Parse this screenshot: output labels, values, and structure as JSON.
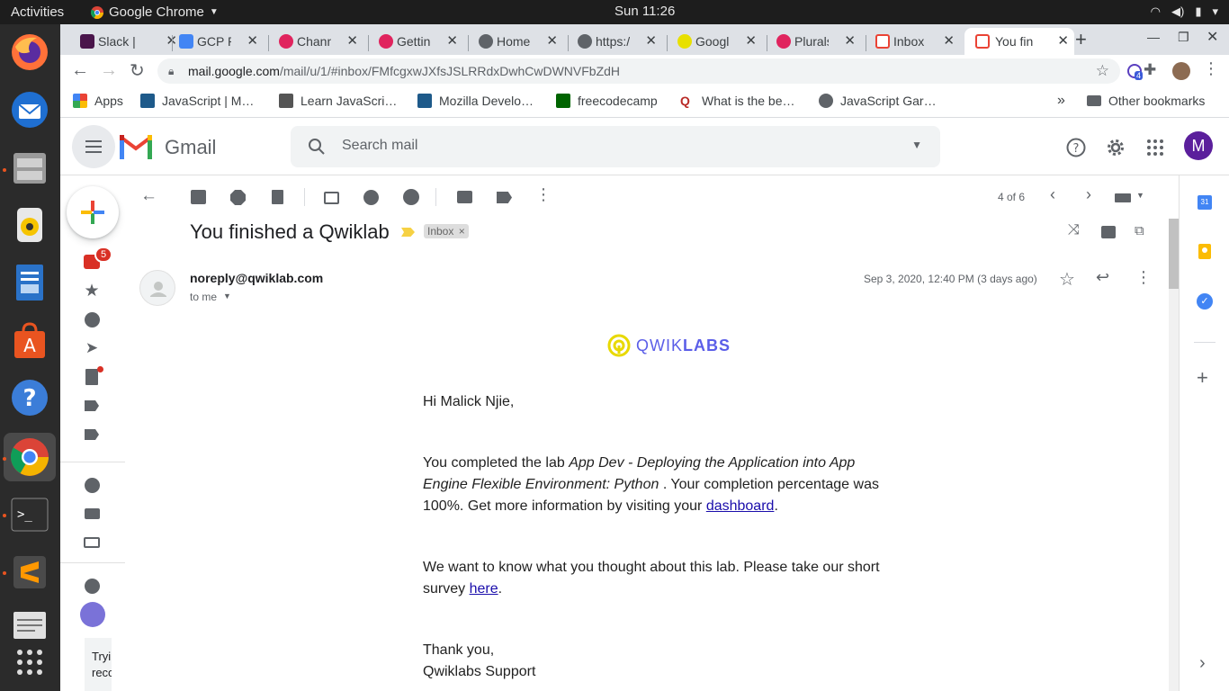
{
  "os": {
    "activities": "Activities",
    "app_name": "Google Chrome",
    "clock": "Sun 11:26"
  },
  "tabs": [
    {
      "label": "Slack | ",
      "color": "#4a154b"
    },
    {
      "label": "GCP Pr",
      "color": "#4285f4"
    },
    {
      "label": "Chann",
      "color": "#e0245e"
    },
    {
      "label": "Getting",
      "color": "#e0245e"
    },
    {
      "label": "Home -",
      "color": "#5f6368"
    },
    {
      "label": "https:/",
      "color": "#5f6368"
    },
    {
      "label": "Google",
      "color": "#e8e000"
    },
    {
      "label": "Plurals",
      "color": "#e0245e"
    },
    {
      "label": "Inbox (",
      "color": "#ea4335"
    },
    {
      "label": "You fin",
      "color": "#ea4335"
    }
  ],
  "url": {
    "host": "mail.google.com",
    "path": "/mail/u/1/#inbox/FMfcgxwJXfsJSLRRdxDwhCwDWNVFbZdH"
  },
  "extensions": {
    "badge": "4"
  },
  "bookmarks": [
    {
      "label": "Apps",
      "color": "#4285f4"
    },
    {
      "label": "JavaScript | M…",
      "color": "#1e5a8a"
    },
    {
      "label": "Learn JavaScri…",
      "color": "#555555"
    },
    {
      "label": "Mozilla Develo…",
      "color": "#1e5a8a"
    },
    {
      "label": "freecodecamp",
      "color": "#006400"
    },
    {
      "label": "What is the be…",
      "color": "#b92b27"
    },
    {
      "label": "JavaScript Gar…",
      "color": "#5f6368"
    }
  ],
  "bookmarks_more": "»",
  "other_bookmarks": "Other bookmarks",
  "gmail": {
    "brand": "Gmail",
    "search_placeholder": "Search mail",
    "avatar": "M",
    "inbox_badge": "5",
    "pagination": "4 of 6",
    "left_bottom_text_1": "Tryi",
    "left_bottom_text_2": "reco"
  },
  "email": {
    "subject": "You finished a Qwiklab",
    "label": "Inbox",
    "sender": "noreply@qwiklab.com",
    "recipient": "to me",
    "date": "Sep 3, 2020, 12:40 PM (3 days ago)",
    "logo_a": "QWIK",
    "logo_b": "LABS",
    "greeting": "Hi Malick Njie,",
    "p1_pre": "You completed the lab ",
    "p1_em": "App Dev - Deploying the Application into App Engine Flexible Environment: Python",
    "p1_post": " . Your completion percentage was 100%. Get more information by visiting your ",
    "p1_link": "dashboard",
    "p1_end": ".",
    "p2_pre": "We want to know what you thought about this lab. Please take our short survey ",
    "p2_link": "here",
    "p2_end": ".",
    "signoff": "Thank you,",
    "signature": "Qwiklabs Support"
  }
}
